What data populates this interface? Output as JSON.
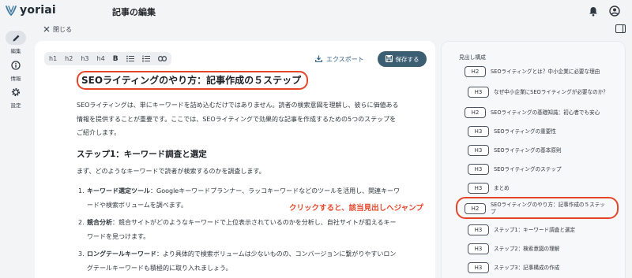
{
  "app": {
    "logo_text": "yoriai",
    "page_title": "記事の編集"
  },
  "sidebar": {
    "items": [
      {
        "label": "編集",
        "icon": "pencil-icon",
        "active": true
      },
      {
        "label": "情報",
        "icon": "info-icon",
        "active": false
      },
      {
        "label": "設定",
        "icon": "gear-icon",
        "active": false
      }
    ]
  },
  "nav": {
    "close_label": "閉じる"
  },
  "toolbar": {
    "h1": "h1",
    "h2": "h2",
    "h3": "h3",
    "h4": "h4",
    "bold": "B",
    "export_label": "エクスポート",
    "save_label": "保存する"
  },
  "article": {
    "h2": "SEOライティングのやり方：記事作成の５ステップ",
    "intro": "SEOライティングは、単にキーワードを詰め込むだけではありません。読者の検索意図を理解し、彼らに価値ある情報を提供することが重要です。ここでは、SEOライティングで効果的な記事を作成するための5つのステップをご紹介します。",
    "h3": "ステップ1：キーワード調査と選定",
    "lead": "まず、どのようなキーワードで読者が検索するのかを調査します。",
    "list": [
      {
        "num": "1.",
        "term": "キーワード選定ツール",
        "text": "：Googleキーワードプランナー、ラッコキーワードなどのツールを活用し、関連キーワードや検索ボリュームを調べます。"
      },
      {
        "num": "2.",
        "term": "競合分析",
        "text": "：競合サイトがどのようなキーワードで上位表示されているのかを分析し、自社サイトが狙えるキーワードを見つけます。"
      },
      {
        "num": "3.",
        "term": "ロングテールキーワード",
        "text": "：より具体的で検索ボリュームは少ないものの、コンバージョンに繋がりやすいロングテールキーワードも積極的に取り入れましょう。"
      }
    ]
  },
  "outline": {
    "title": "見出し構成",
    "items": [
      {
        "level": "H2",
        "text": "SEOライティングとは？中小企業に必要な理由"
      },
      {
        "level": "H3",
        "text": "なぜ中小企業にSEOライティングが必要なのか？"
      },
      {
        "level": "H2",
        "text": "SEOライティングの基礎知識：初心者でも安心"
      },
      {
        "level": "H3",
        "text": "SEOライティングの重要性"
      },
      {
        "level": "H3",
        "text": "SEOライティングの基本原則"
      },
      {
        "level": "H3",
        "text": "SEOライティングのステップ"
      },
      {
        "level": "H3",
        "text": "まとめ"
      },
      {
        "level": "H2",
        "text": "SEOライティングのやり方：記事作成の５ステップ"
      },
      {
        "level": "H3",
        "text": "ステップ1：キーワード調査と選定"
      },
      {
        "level": "H3",
        "text": "ステップ2：検索意図の理解"
      },
      {
        "level": "H3",
        "text": "ステップ3：記事構成の作成"
      }
    ]
  },
  "annotation": "クリックすると、該当見出しへジャンプ",
  "colors": {
    "accent_red": "#e5462a",
    "save_button": "#3c5e72",
    "export_text": "#325f86"
  }
}
